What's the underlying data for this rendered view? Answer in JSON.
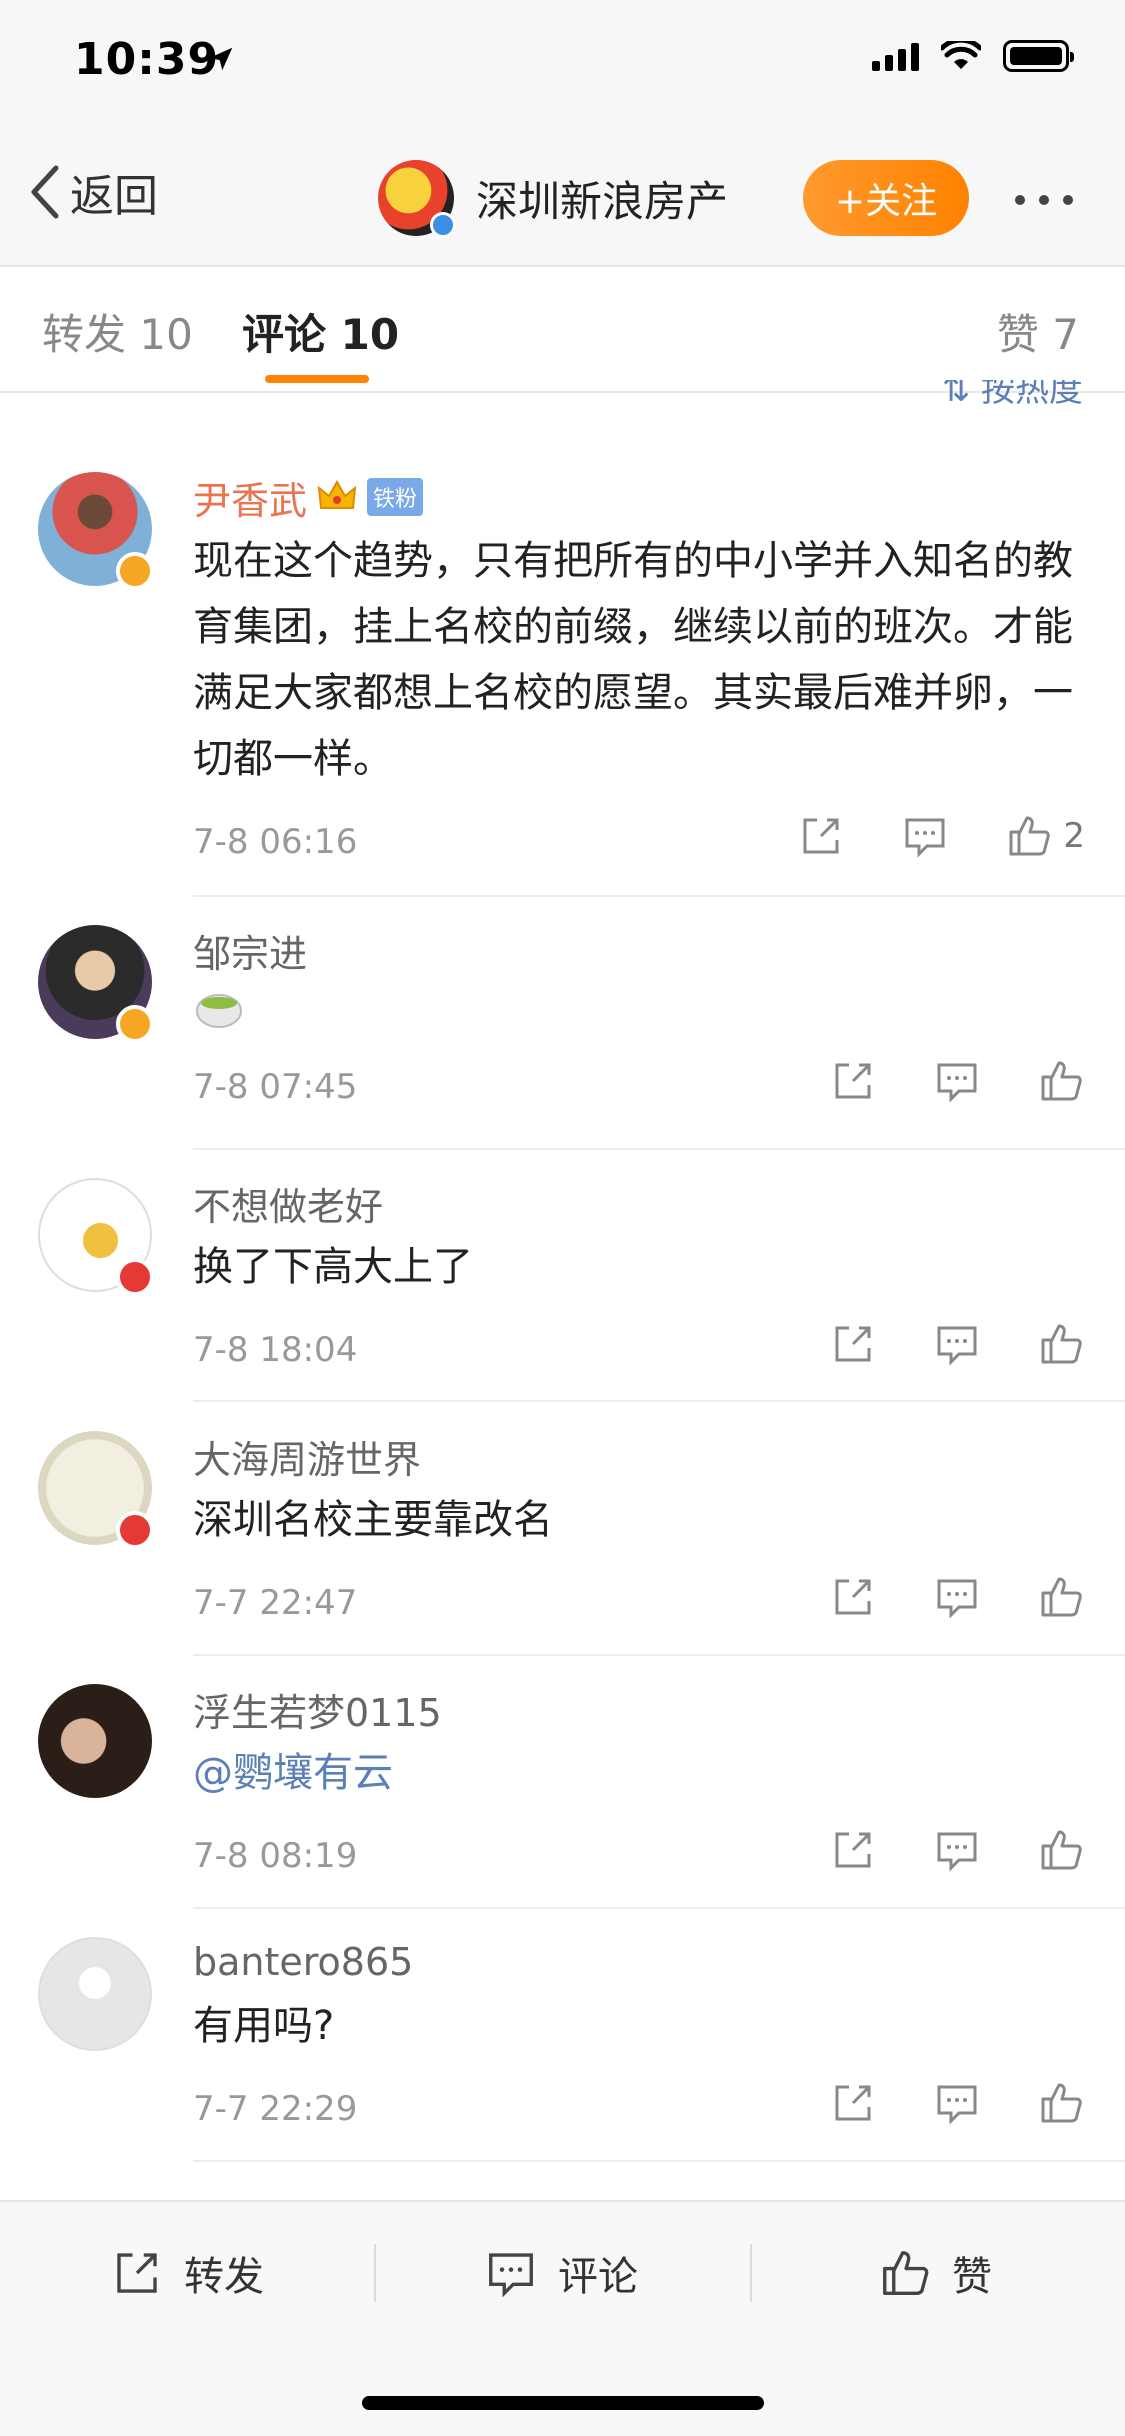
{
  "status_bar": {
    "time": "10:39"
  },
  "nav": {
    "back_label": "返回",
    "account_name": "深圳新浪房产",
    "follow_label": "+关注"
  },
  "tabs": {
    "repost": "转发 10",
    "comment": "评论 10",
    "like": "赞 7"
  },
  "sort_label": "按热度",
  "comments": [
    {
      "user": "尹香武",
      "fan_badge": "铁粉",
      "text": "现在这个趋势，只有把所有的中小学并入知名的教育集团，挂上名校的前缀，继续以前的班次。才能满足大家都想上名校的愿望。其实最后难并卵，一切都一样。",
      "time": "7-8 06:16",
      "likes": "2"
    },
    {
      "user": "邹宗进",
      "text": "",
      "time": "7-8 07:45"
    },
    {
      "user": "不想做老好",
      "text": "换了下高大上了",
      "time": "7-8 18:04"
    },
    {
      "user": "大海周游世界",
      "text": "深圳名校主要靠改名",
      "time": "7-7 22:47"
    },
    {
      "user": "浮生若梦0115",
      "text": "@鹦壤有云",
      "time": "7-8 08:19"
    },
    {
      "user": "bantero865",
      "text": "有用吗?",
      "time": "7-7 22:29"
    }
  ],
  "bottom_bar": {
    "repost": "转发",
    "comment": "评论",
    "like": "赞"
  },
  "colors": {
    "accent": "#ff8200",
    "link": "#5b7fb6",
    "username_vip": "#eb7350"
  }
}
